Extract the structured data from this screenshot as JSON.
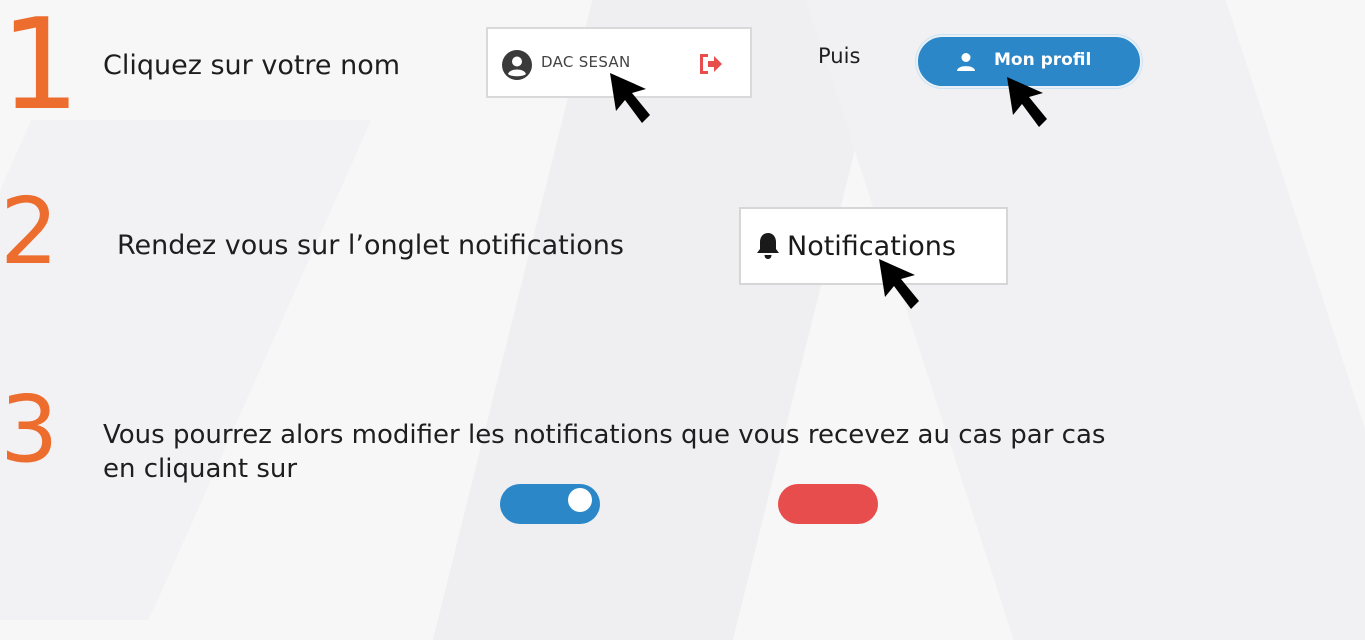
{
  "steps": [
    {
      "number": "1",
      "text": "Cliquez sur votre nom"
    },
    {
      "number": "2",
      "text": "Rendez vous sur l’onglet notifications"
    },
    {
      "number": "3",
      "text_line1": "Vous pourrez alors modifier les notifications que vous recevez au cas par cas",
      "text_line2": "en cliquant sur"
    }
  ],
  "puis_label": "Puis",
  "user_box": {
    "name": "DAC SESAN",
    "avatar_icon": "user-circle-icon",
    "logout_icon": "sign-out-icon"
  },
  "profil_button": {
    "label": "Mon profil",
    "icon": "user-icon"
  },
  "notifications_tab": {
    "label": "Notifications",
    "icon": "bell-icon"
  },
  "colors": {
    "accent_orange": "#ed6d2e",
    "button_blue": "#2b87c8",
    "logout_red": "#e84d4d",
    "toggle_off_red": "#e84d4d"
  }
}
